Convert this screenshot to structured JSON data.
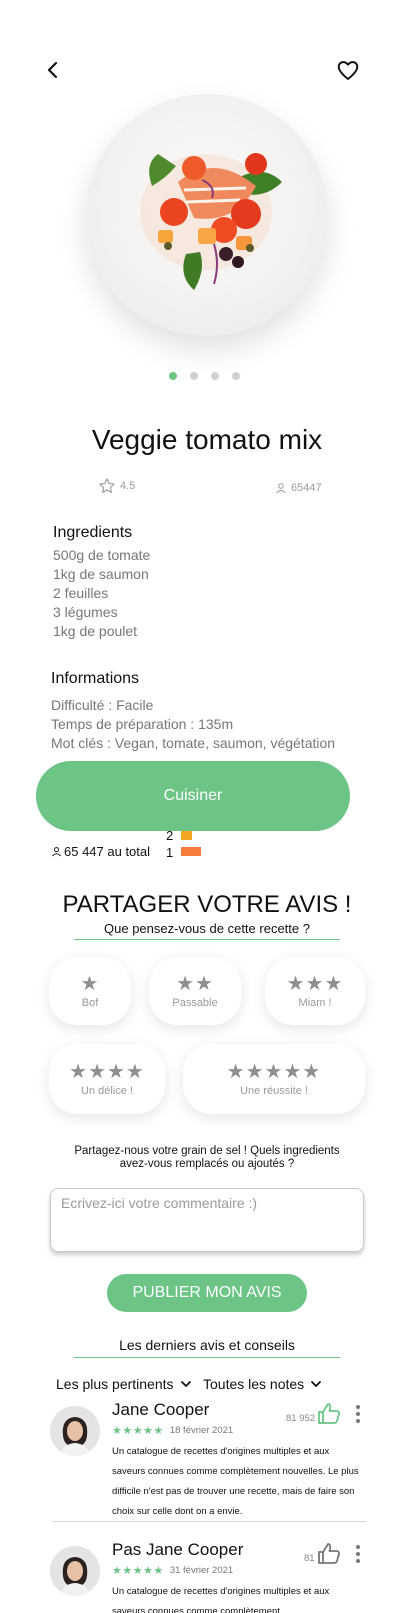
{
  "recipe": {
    "title": "Veggie tomato mix",
    "rating": "4.5",
    "users": "65447",
    "carousel": {
      "count": 4,
      "active": 0
    }
  },
  "ingredients": {
    "title": "Ingredients",
    "items": [
      "500g de tomate",
      "1kg de saumon",
      "2 feuilles",
      "3 légumes",
      "1kg de poulet"
    ]
  },
  "informations": {
    "title": "Informations",
    "difficulty": "Difficulté : Facile",
    "prep_time": "Temps de préparation : 135m",
    "keywords": "Mot clés : Vegan, tomate, saumon, végétation"
  },
  "cook_button": "Cuisiner",
  "ratings_summary": {
    "total_label": "65 447 au total",
    "rows": [
      {
        "label": "2",
        "color": "#f3a621"
      },
      {
        "label": "1",
        "color": "#f57c3a"
      }
    ]
  },
  "share": {
    "title": "PARTAGER VOTRE AVIS !",
    "subtitle": "Que pensez-vous de cette recette ?",
    "options": [
      {
        "stars": "★",
        "label": "Bof"
      },
      {
        "stars": "★★",
        "label": "Passable"
      },
      {
        "stars": "★★★",
        "label": "Miam !"
      },
      {
        "stars": "★★★★",
        "label": "Un délice !"
      },
      {
        "stars": "★★★★★",
        "label": "Une réussite !"
      }
    ],
    "prompt": "Partagez-nous votre grain de sel ! Quels ingredients avez-vous remplacés ou ajoutés ?",
    "comment_placeholder": "Ecrivez-ici votre commentaire :)",
    "publish": "PUBLIER MON AVIS"
  },
  "reviews": {
    "title": "Les derniers avis et conseils",
    "filter_sort": "Les plus pertinents",
    "filter_notes": "Toutes les notes",
    "items": [
      {
        "name": "Jane Cooper",
        "stars": "★★★★★",
        "date": "18 février 2021",
        "likes": "81 952",
        "text": "Un catalogue de recettes d'origines multiples et aux saveurs connues comme complètement nouvelles. Le plus difficile n'est pas de trouver une recette, mais de faire son choix sur celle dont on a envie."
      },
      {
        "name": "Pas Jane Cooper",
        "stars": "★★★★★",
        "date": "31 février 2021",
        "likes": "81",
        "text": "Un catalogue de recettes d'origines multiples et aux saveurs connues comme complètement"
      }
    ]
  },
  "colors": {
    "accent": "#6cc487",
    "muted": "#9a9a9a"
  }
}
